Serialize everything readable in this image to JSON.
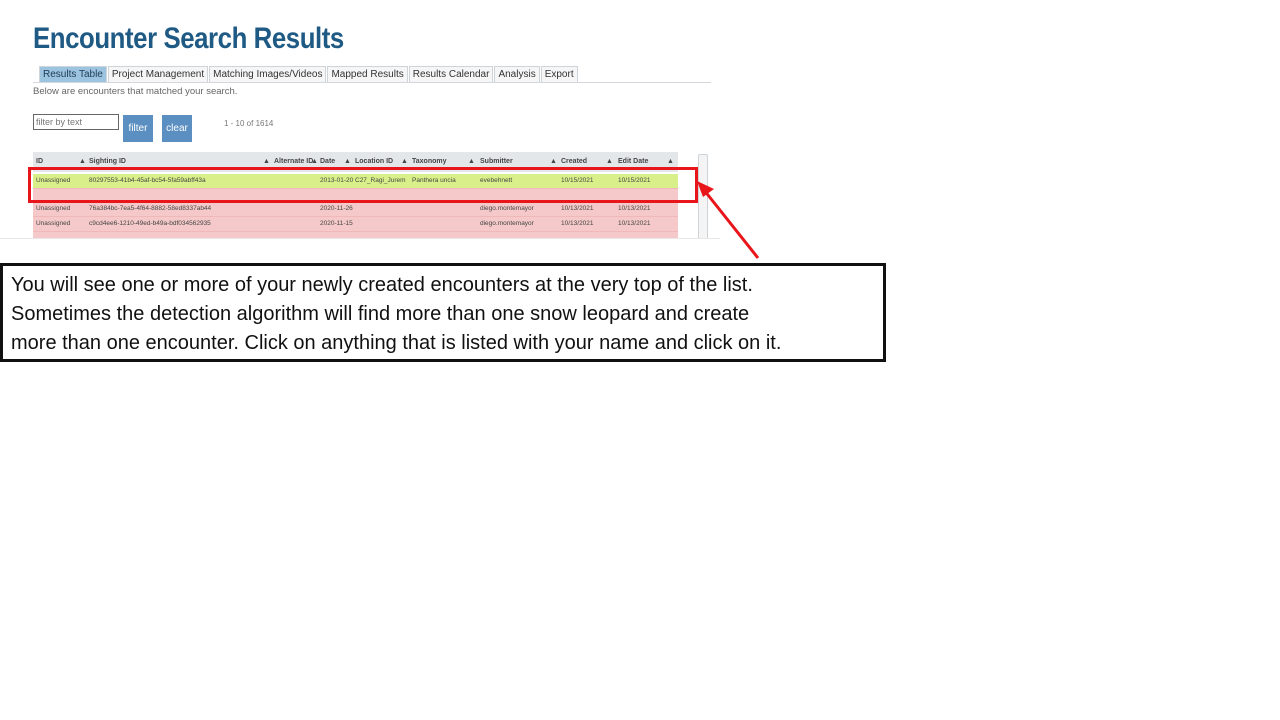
{
  "header": {
    "title": "Encounter Search Results"
  },
  "tabs": [
    {
      "label": "Results Table",
      "active": true
    },
    {
      "label": "Project Management",
      "active": false
    },
    {
      "label": "Matching Images/Videos",
      "active": false
    },
    {
      "label": "Mapped Results",
      "active": false
    },
    {
      "label": "Results Calendar",
      "active": false
    },
    {
      "label": "Analysis",
      "active": false
    },
    {
      "label": "Export",
      "active": false
    }
  ],
  "intro_text": "Below are encounters that matched your search.",
  "filter": {
    "placeholder": "filter by text",
    "filter_label": "filter",
    "clear_label": "clear",
    "pagination": "1 - 10 of 1614"
  },
  "table": {
    "columns": [
      "ID",
      "Sighting ID",
      "Alternate ID",
      "Date",
      "Location ID",
      "Taxonomy",
      "Submitter",
      "Created",
      "Edit Date"
    ],
    "rows": [
      {
        "id": "Unassigned",
        "sighting": "80297553-41b4-45af-bc54-5fa59abff43a",
        "date": "2013-01-20",
        "location": "C27_Ragi_Jurem",
        "taxonomy": "Panthera uncia",
        "submitter": "evebehnett",
        "created": "10/15/2021",
        "edit": "10/15/2021"
      },
      {
        "id": "Unassigned",
        "sighting": "76a384bc-7ea5-4f64-8882-58ed8337ab44",
        "date": "2020-11-26",
        "location": "",
        "taxonomy": "",
        "submitter": "diego.montemayor",
        "created": "10/13/2021",
        "edit": "10/13/2021"
      },
      {
        "id": "Unassigned",
        "sighting": "c9cd4ee6-1210-49ed-b49a-bdf034562935",
        "date": "2020-11-15",
        "location": "",
        "taxonomy": "",
        "submitter": "diego.montemayor",
        "created": "10/13/2021",
        "edit": "10/13/2021"
      }
    ]
  },
  "callout": {
    "lines": [
      "You will see one or more of your newly created encounters at the very top of the list.",
      "Sometimes the detection algorithm will find more than one snow leopard and create",
      "more than one encounter. Click on anything that is listed with your name and click on it."
    ]
  },
  "colors": {
    "title": "#1f5a85",
    "highlight": "#e8151b",
    "button": "#5b8fc2",
    "row_green": "#d9f08a",
    "row_pink": "#f5c9c9"
  }
}
